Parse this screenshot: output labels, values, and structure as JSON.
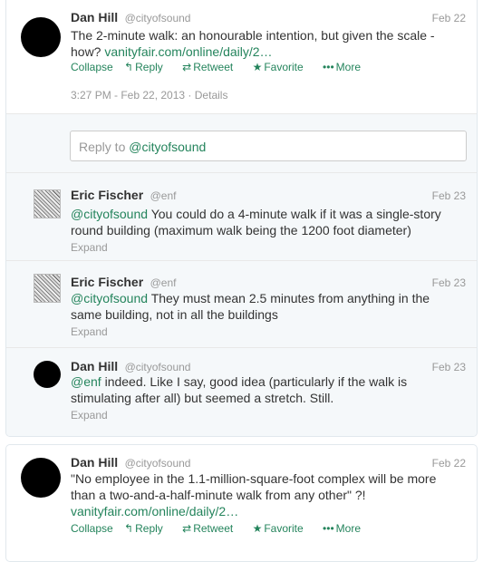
{
  "actions": {
    "collapse": "Collapse",
    "reply": "Reply",
    "retweet": "Retweet",
    "favorite": "Favorite",
    "more": "More",
    "expand": "Expand"
  },
  "main_tweet": {
    "name": "Dan Hill",
    "handle": "@cityofsound",
    "date": "Feb 22",
    "text": "The 2-minute walk: an honourable intention, but given the scale - how?",
    "link": "vanityfair.com/online/daily/2…",
    "timestamp": "3:27 PM - Feb 22, 2013",
    "separator": "·",
    "details": "Details"
  },
  "reply_box": {
    "placeholder_prefix": "Reply to",
    "mention": "@cityofsound"
  },
  "replies": [
    {
      "name": "Eric Fischer",
      "handle": "@enf",
      "date": "Feb 23",
      "mention": "@cityofsound",
      "text": "You could do a 4-minute walk if it was a single-story round building (maximum walk being the 1200 foot diameter)"
    },
    {
      "name": "Eric Fischer",
      "handle": "@enf",
      "date": "Feb 23",
      "mention": "@cityofsound",
      "text": "They must mean 2.5 minutes from anything in the same building, not in all the buildings"
    },
    {
      "name": "Dan Hill",
      "handle": "@cityofsound",
      "date": "Feb 23",
      "mention": "@enf",
      "text": "indeed. Like I say, good idea (particularly if the walk is stimulating after all) but seemed a stretch. Still."
    }
  ],
  "second_tweet": {
    "name": "Dan Hill",
    "handle": "@cityofsound",
    "date": "Feb 22",
    "text": "\"No employee in the 1.1-million-square-foot complex will be more than a two-and-a-half-minute walk from any other\" ?!",
    "link": "vanityfair.com/online/daily/2…"
  },
  "icons": {
    "reply": "reply-icon",
    "retweet": "retweet-icon",
    "favorite": "star-icon",
    "more": "more-dots-icon"
  },
  "colors": {
    "link": "#24845c",
    "muted": "#999999",
    "text": "#333333",
    "reply_bg": "#f5f8fa"
  }
}
